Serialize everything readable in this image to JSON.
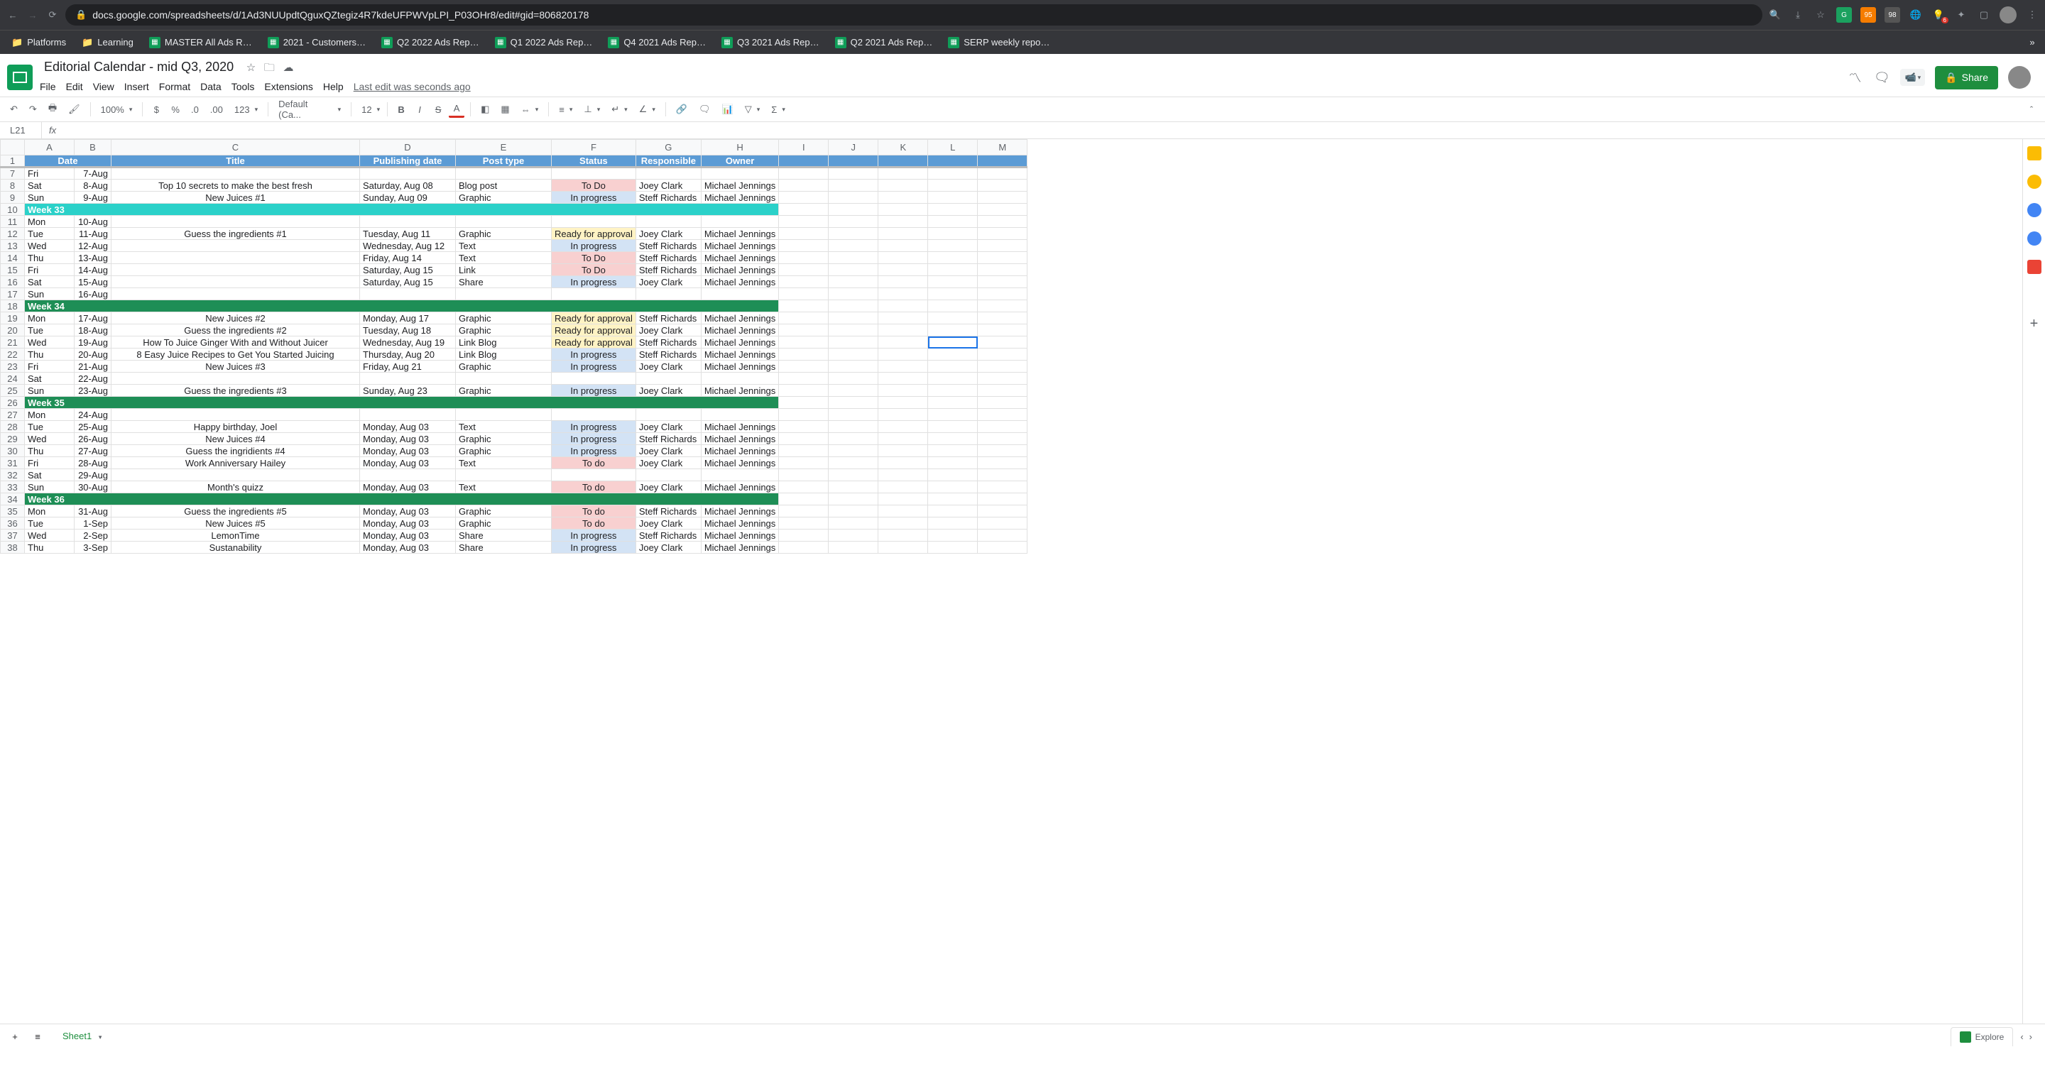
{
  "browser": {
    "url": "docs.google.com/spreadsheets/d/1Ad3NUUpdtQguxQZtegiz4R7kdeUFPWVpLPI_P03OHr8/edit#gid=806820178",
    "bookmarks": [
      {
        "label": "Platforms",
        "type": "folder"
      },
      {
        "label": "Learning",
        "type": "folder"
      },
      {
        "label": "MASTER All Ads R…",
        "type": "sheet"
      },
      {
        "label": "2021 - Customers…",
        "type": "sheet"
      },
      {
        "label": "Q2 2022 Ads Rep…",
        "type": "sheet"
      },
      {
        "label": "Q1 2022 Ads Rep…",
        "type": "sheet"
      },
      {
        "label": "Q4 2021 Ads Rep…",
        "type": "sheet"
      },
      {
        "label": "Q3 2021 Ads Rep…",
        "type": "sheet"
      },
      {
        "label": "Q2 2021 Ads Rep…",
        "type": "sheet"
      },
      {
        "label": "SERP weekly repo…",
        "type": "sheet"
      }
    ],
    "ext_badges": {
      "orange": "95",
      "grey": "98",
      "red": "6"
    }
  },
  "doc": {
    "title": "Editorial Calendar - mid Q3, 2020",
    "menus": [
      "File",
      "Edit",
      "View",
      "Insert",
      "Format",
      "Data",
      "Tools",
      "Extensions",
      "Help"
    ],
    "last_edit": "Last edit was seconds ago",
    "share": "Share",
    "namebox": "L21",
    "zoom": "100%",
    "font": "Default (Ca...",
    "fontsize": "12",
    "sheet_tab": "Sheet1",
    "explore": "Explore"
  },
  "columns": {
    "letters": [
      "A",
      "B",
      "C",
      "D",
      "E",
      "F",
      "G",
      "H",
      "I",
      "J",
      "K",
      "L",
      "M"
    ],
    "headers": {
      "AB": "Date",
      "C": "Title",
      "D": "Publishing date",
      "E": "Post type",
      "F": "Status",
      "G": "Responsible",
      "H": "Owner"
    }
  },
  "rows": [
    {
      "n": 7,
      "day": "Fri",
      "date": "7-Aug"
    },
    {
      "n": 8,
      "day": "Sat",
      "date": "8-Aug",
      "title": "Top 10 secrets to make the best fresh",
      "pub": "Saturday, Aug 08",
      "type": "Blog post",
      "status": "To Do",
      "stcls": "st-todo",
      "resp": "Joey Clark",
      "owner": "Michael Jennings"
    },
    {
      "n": 9,
      "day": "Sun",
      "date": "9-Aug",
      "title": "New Juices #1",
      "pub": "Sunday, Aug 09",
      "type": "Graphic",
      "status": "In progress",
      "stcls": "st-inprogress",
      "resp": "Steff Richards",
      "owner": "Michael Jennings"
    },
    {
      "n": 10,
      "week": "Week 33",
      "wcls": "week-cyan"
    },
    {
      "n": 11,
      "day": "Mon",
      "date": "10-Aug"
    },
    {
      "n": 12,
      "day": "Tue",
      "date": "11-Aug",
      "title": "Guess the ingredients #1",
      "pub": "Tuesday, Aug 11",
      "type": "Graphic",
      "status": "Ready for approval",
      "stcls": "st-ready",
      "resp": "Joey Clark",
      "owner": "Michael Jennings"
    },
    {
      "n": 13,
      "day": "Wed",
      "date": "12-Aug",
      "pub": "Wednesday, Aug 12",
      "type": "Text",
      "status": "In progress",
      "stcls": "st-inprogress",
      "resp": "Steff Richards",
      "owner": "Michael Jennings"
    },
    {
      "n": 14,
      "day": "Thu",
      "date": "13-Aug",
      "pub": "Friday, Aug 14",
      "type": "Text",
      "status": "To Do",
      "stcls": "st-todo",
      "resp": "Steff Richards",
      "owner": "Michael Jennings"
    },
    {
      "n": 15,
      "day": "Fri",
      "date": "14-Aug",
      "pub": "Saturday, Aug 15",
      "type": "Link",
      "status": "To Do",
      "stcls": "st-todo",
      "resp": "Steff Richards",
      "owner": "Michael Jennings"
    },
    {
      "n": 16,
      "day": "Sat",
      "date": "15-Aug",
      "pub": "Saturday, Aug 15",
      "type": "Share",
      "status": "In progress",
      "stcls": "st-inprogress",
      "resp": "Joey Clark",
      "owner": "Michael Jennings"
    },
    {
      "n": 17,
      "day": "Sun",
      "date": "16-Aug"
    },
    {
      "n": 18,
      "week": "Week 34",
      "wcls": "week-green"
    },
    {
      "n": 19,
      "day": "Mon",
      "date": "17-Aug",
      "title": "New Juices #2",
      "pub": "Monday, Aug 17",
      "type": "Graphic",
      "status": "Ready for approval",
      "stcls": "st-ready",
      "resp": "Steff Richards",
      "owner": "Michael Jennings"
    },
    {
      "n": 20,
      "day": "Tue",
      "date": "18-Aug",
      "title": "Guess the ingredients #2",
      "pub": "Tuesday, Aug 18",
      "type": "Graphic",
      "status": "Ready for approval",
      "stcls": "st-ready",
      "resp": "Joey Clark",
      "owner": "Michael Jennings"
    },
    {
      "n": 21,
      "day": "Wed",
      "date": "19-Aug",
      "title": "How To Juice Ginger With and Without Juicer",
      "pub": "Wednesday, Aug 19",
      "type": "Link Blog",
      "status": "Ready for approval",
      "stcls": "st-ready",
      "resp": "Steff Richards",
      "owner": "Michael Jennings"
    },
    {
      "n": 22,
      "day": "Thu",
      "date": "20-Aug",
      "title": "8 Easy Juice Recipes to Get You Started Juicing",
      "pub": "Thursday, Aug 20",
      "type": "Link Blog",
      "status": "In progress",
      "stcls": "st-inprogress",
      "resp": "Steff Richards",
      "owner": "Michael Jennings"
    },
    {
      "n": 23,
      "day": "Fri",
      "date": "21-Aug",
      "title": "New Juices #3",
      "pub": "Friday, Aug 21",
      "type": "Graphic",
      "status": "In progress",
      "stcls": "st-inprogress",
      "resp": "Joey Clark",
      "owner": "Michael Jennings"
    },
    {
      "n": 24,
      "day": "Sat",
      "date": "22-Aug"
    },
    {
      "n": 25,
      "day": "Sun",
      "date": "23-Aug",
      "title": "Guess the ingredients #3",
      "pub": "Sunday, Aug 23",
      "type": "Graphic",
      "status": "In progress",
      "stcls": "st-inprogress",
      "resp": "Joey Clark",
      "owner": "Michael Jennings"
    },
    {
      "n": 26,
      "week": "Week 35",
      "wcls": "week-green"
    },
    {
      "n": 27,
      "day": "Mon",
      "date": "24-Aug"
    },
    {
      "n": 28,
      "day": "Tue",
      "date": "25-Aug",
      "title": "Happy birthday, Joel",
      "pub": "Monday, Aug 03",
      "type": "Text",
      "status": "In progress",
      "stcls": "st-inprogress",
      "resp": "Joey Clark",
      "owner": "Michael Jennings"
    },
    {
      "n": 29,
      "day": "Wed",
      "date": "26-Aug",
      "title": "New Juices #4",
      "pub": "Monday, Aug 03",
      "type": "Graphic",
      "status": "In progress",
      "stcls": "st-inprogress",
      "resp": "Steff Richards",
      "owner": "Michael Jennings"
    },
    {
      "n": 30,
      "day": "Thu",
      "date": "27-Aug",
      "title": "Guess the ingridients #4",
      "pub": "Monday, Aug 03",
      "type": "Graphic",
      "status": "In progress",
      "stcls": "st-inprogress",
      "resp": "Joey Clark",
      "owner": "Michael Jennings"
    },
    {
      "n": 31,
      "day": "Fri",
      "date": "28-Aug",
      "title": "Work Anniversary Hailey",
      "pub": "Monday, Aug 03",
      "type": "Text",
      "status": "To do",
      "stcls": "st-todo",
      "resp": "Joey Clark",
      "owner": "Michael Jennings"
    },
    {
      "n": 32,
      "day": "Sat",
      "date": "29-Aug"
    },
    {
      "n": 33,
      "day": "Sun",
      "date": "30-Aug",
      "title": "Month's quizz",
      "pub": "Monday, Aug 03",
      "type": "Text",
      "status": "To do",
      "stcls": "st-todo",
      "resp": "Joey Clark",
      "owner": "Michael Jennings"
    },
    {
      "n": 34,
      "week": "Week 36",
      "wcls": "week-green"
    },
    {
      "n": 35,
      "day": "Mon",
      "date": "31-Aug",
      "title": "Guess the ingredients #5",
      "pub": "Monday, Aug 03",
      "type": "Graphic",
      "status": "To do",
      "stcls": "st-todo",
      "resp": "Steff Richards",
      "owner": "Michael Jennings"
    },
    {
      "n": 36,
      "day": "Tue",
      "date": "1-Sep",
      "title": "New Juices #5",
      "pub": "Monday, Aug 03",
      "type": "Graphic",
      "status": "To do",
      "stcls": "st-todo",
      "resp": "Joey Clark",
      "owner": "Michael Jennings"
    },
    {
      "n": 37,
      "day": "Wed",
      "date": "2-Sep",
      "title": "LemonTime",
      "pub": "Monday, Aug 03",
      "type": "Share",
      "status": "In progress",
      "stcls": "st-inprogress",
      "resp": "Steff Richards",
      "owner": "Michael Jennings"
    },
    {
      "n": 38,
      "day": "Thu",
      "date": "3-Sep",
      "title": "Sustanability",
      "pub": "Monday, Aug 03",
      "type": "Share",
      "status": "In progress",
      "stcls": "st-inprogress",
      "resp": "Joey Clark",
      "owner": "Michael Jennings"
    }
  ]
}
